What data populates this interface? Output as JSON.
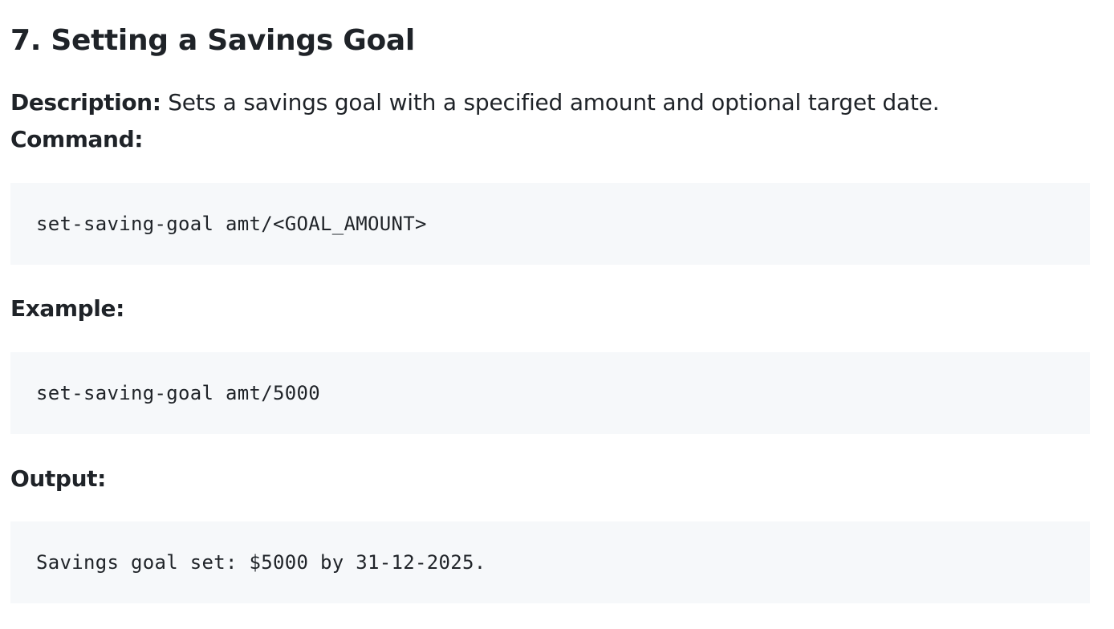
{
  "section": {
    "heading": "7. Setting a Savings Goal",
    "description_label": "Description:",
    "description_text": " Sets a savings goal with a specified amount and optional target date.",
    "command_label": "Command:",
    "command_code": "set-saving-goal amt/<GOAL_AMOUNT>",
    "example_label": "Example:",
    "example_code": "set-saving-goal amt/5000",
    "output_label": "Output:",
    "output_code": "Savings goal set: $5000 by 31-12-2025."
  }
}
